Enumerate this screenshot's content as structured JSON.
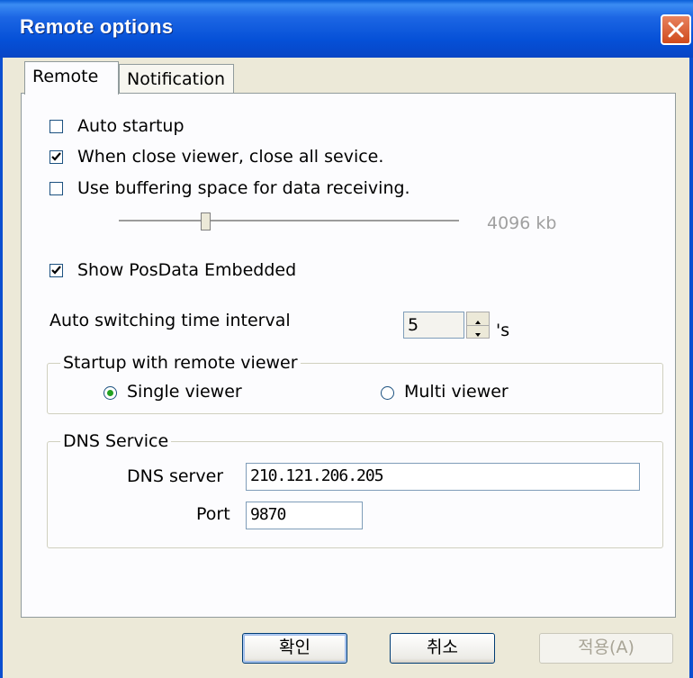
{
  "window": {
    "title": "Remote options"
  },
  "tabs": [
    {
      "label": "Remote"
    },
    {
      "label": "Notification"
    }
  ],
  "remote": {
    "auto_startup": {
      "label": "Auto startup",
      "checked": false
    },
    "close_all": {
      "label": "When close viewer, close all sevice.",
      "checked": true
    },
    "buffering": {
      "label": "Use buffering space for data receiving.",
      "checked": false
    },
    "buffer_size_label": "4096 kb",
    "show_posdata": {
      "label": "Show PosData Embedded",
      "checked": true
    },
    "switch_interval": {
      "label": "Auto switching time interval",
      "value": "5",
      "unit": "'s"
    },
    "startup_group": {
      "title": "Startup with remote viewer",
      "single": {
        "label": "Single viewer",
        "selected": true
      },
      "multi": {
        "label": "Multi viewer",
        "selected": false
      }
    },
    "dns_group": {
      "title": "DNS Service",
      "server_label": "DNS server",
      "server_value": "210.121.206.205",
      "port_label": "Port",
      "port_value": "9870"
    }
  },
  "buttons": {
    "ok": "확인",
    "cancel": "취소",
    "apply": "적용(A)"
  },
  "icons": {
    "close": "close-icon",
    "check": "check-icon"
  }
}
